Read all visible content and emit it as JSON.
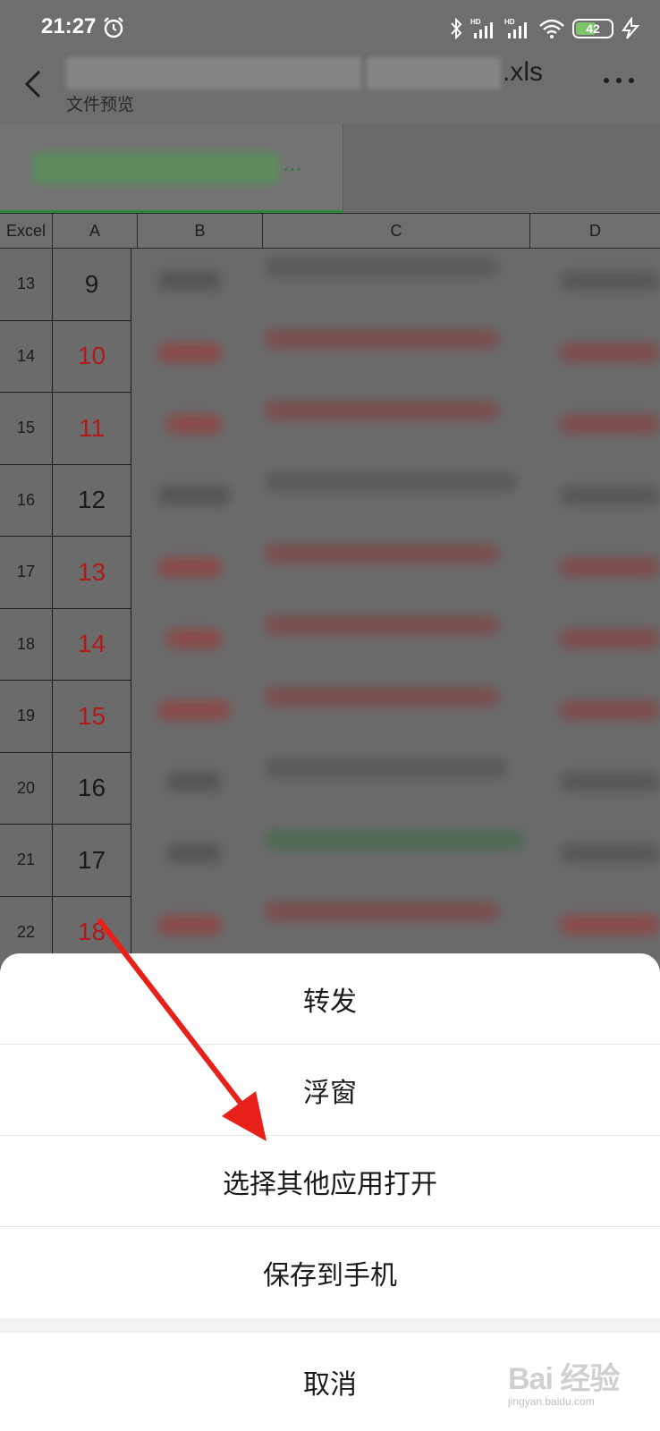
{
  "status_bar": {
    "time": "21:27",
    "battery_level": "42",
    "icons": [
      "alarm-icon",
      "bluetooth-icon",
      "signal-hd-icon",
      "signal-hd-icon",
      "wifi-icon",
      "battery-icon",
      "charging-icon"
    ]
  },
  "header": {
    "title_suffix": ".xls",
    "subtitle": "文件预览"
  },
  "sheet_tab": {
    "more_text": "…"
  },
  "grid": {
    "corner": "Excel",
    "columns": [
      "A",
      "B",
      "C",
      "D"
    ],
    "rows": [
      {
        "num": "13",
        "a": "9",
        "a_color": "#1a1a1a"
      },
      {
        "num": "14",
        "a": "10",
        "a_color": "#b01a1a"
      },
      {
        "num": "15",
        "a": "11",
        "a_color": "#b01a1a"
      },
      {
        "num": "16",
        "a": "12",
        "a_color": "#1a1a1a"
      },
      {
        "num": "17",
        "a": "13",
        "a_color": "#b01a1a"
      },
      {
        "num": "18",
        "a": "14",
        "a_color": "#b01a1a"
      },
      {
        "num": "19",
        "a": "15",
        "a_color": "#b01a1a"
      },
      {
        "num": "20",
        "a": "16",
        "a_color": "#1a1a1a"
      },
      {
        "num": "21",
        "a": "17",
        "a_color": "#1a1a1a"
      },
      {
        "num": "22",
        "a": "18",
        "a_color": "#b01a1a"
      }
    ]
  },
  "action_sheet": {
    "options": [
      "转发",
      "浮窗",
      "选择其他应用打开",
      "保存到手机"
    ],
    "cancel": "取消"
  },
  "watermark": {
    "brand": "Bai 经验",
    "url": "jingyan.baidu.com"
  },
  "colors": {
    "overlay": "#6b6b6b",
    "accent_green": "#2e8a3e",
    "red_text": "#b01a1a",
    "annotation_arrow": "#e8201a"
  }
}
